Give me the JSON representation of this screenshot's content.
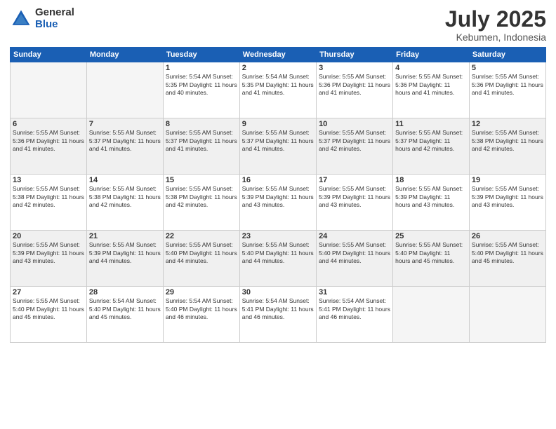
{
  "logo": {
    "general": "General",
    "blue": "Blue"
  },
  "title": "July 2025",
  "location": "Kebumen, Indonesia",
  "days_header": [
    "Sunday",
    "Monday",
    "Tuesday",
    "Wednesday",
    "Thursday",
    "Friday",
    "Saturday"
  ],
  "weeks": [
    [
      {
        "day": "",
        "info": ""
      },
      {
        "day": "",
        "info": ""
      },
      {
        "day": "1",
        "info": "Sunrise: 5:54 AM\nSunset: 5:35 PM\nDaylight: 11 hours and 40 minutes."
      },
      {
        "day": "2",
        "info": "Sunrise: 5:54 AM\nSunset: 5:35 PM\nDaylight: 11 hours and 41 minutes."
      },
      {
        "day": "3",
        "info": "Sunrise: 5:55 AM\nSunset: 5:36 PM\nDaylight: 11 hours and 41 minutes."
      },
      {
        "day": "4",
        "info": "Sunrise: 5:55 AM\nSunset: 5:36 PM\nDaylight: 11 hours and 41 minutes."
      },
      {
        "day": "5",
        "info": "Sunrise: 5:55 AM\nSunset: 5:36 PM\nDaylight: 11 hours and 41 minutes."
      }
    ],
    [
      {
        "day": "6",
        "info": "Sunrise: 5:55 AM\nSunset: 5:36 PM\nDaylight: 11 hours and 41 minutes."
      },
      {
        "day": "7",
        "info": "Sunrise: 5:55 AM\nSunset: 5:37 PM\nDaylight: 11 hours and 41 minutes."
      },
      {
        "day": "8",
        "info": "Sunrise: 5:55 AM\nSunset: 5:37 PM\nDaylight: 11 hours and 41 minutes."
      },
      {
        "day": "9",
        "info": "Sunrise: 5:55 AM\nSunset: 5:37 PM\nDaylight: 11 hours and 41 minutes."
      },
      {
        "day": "10",
        "info": "Sunrise: 5:55 AM\nSunset: 5:37 PM\nDaylight: 11 hours and 42 minutes."
      },
      {
        "day": "11",
        "info": "Sunrise: 5:55 AM\nSunset: 5:37 PM\nDaylight: 11 hours and 42 minutes."
      },
      {
        "day": "12",
        "info": "Sunrise: 5:55 AM\nSunset: 5:38 PM\nDaylight: 11 hours and 42 minutes."
      }
    ],
    [
      {
        "day": "13",
        "info": "Sunrise: 5:55 AM\nSunset: 5:38 PM\nDaylight: 11 hours and 42 minutes."
      },
      {
        "day": "14",
        "info": "Sunrise: 5:55 AM\nSunset: 5:38 PM\nDaylight: 11 hours and 42 minutes."
      },
      {
        "day": "15",
        "info": "Sunrise: 5:55 AM\nSunset: 5:38 PM\nDaylight: 11 hours and 42 minutes."
      },
      {
        "day": "16",
        "info": "Sunrise: 5:55 AM\nSunset: 5:39 PM\nDaylight: 11 hours and 43 minutes."
      },
      {
        "day": "17",
        "info": "Sunrise: 5:55 AM\nSunset: 5:39 PM\nDaylight: 11 hours and 43 minutes."
      },
      {
        "day": "18",
        "info": "Sunrise: 5:55 AM\nSunset: 5:39 PM\nDaylight: 11 hours and 43 minutes."
      },
      {
        "day": "19",
        "info": "Sunrise: 5:55 AM\nSunset: 5:39 PM\nDaylight: 11 hours and 43 minutes."
      }
    ],
    [
      {
        "day": "20",
        "info": "Sunrise: 5:55 AM\nSunset: 5:39 PM\nDaylight: 11 hours and 43 minutes."
      },
      {
        "day": "21",
        "info": "Sunrise: 5:55 AM\nSunset: 5:39 PM\nDaylight: 11 hours and 44 minutes."
      },
      {
        "day": "22",
        "info": "Sunrise: 5:55 AM\nSunset: 5:40 PM\nDaylight: 11 hours and 44 minutes."
      },
      {
        "day": "23",
        "info": "Sunrise: 5:55 AM\nSunset: 5:40 PM\nDaylight: 11 hours and 44 minutes."
      },
      {
        "day": "24",
        "info": "Sunrise: 5:55 AM\nSunset: 5:40 PM\nDaylight: 11 hours and 44 minutes."
      },
      {
        "day": "25",
        "info": "Sunrise: 5:55 AM\nSunset: 5:40 PM\nDaylight: 11 hours and 45 minutes."
      },
      {
        "day": "26",
        "info": "Sunrise: 5:55 AM\nSunset: 5:40 PM\nDaylight: 11 hours and 45 minutes."
      }
    ],
    [
      {
        "day": "27",
        "info": "Sunrise: 5:55 AM\nSunset: 5:40 PM\nDaylight: 11 hours and 45 minutes."
      },
      {
        "day": "28",
        "info": "Sunrise: 5:54 AM\nSunset: 5:40 PM\nDaylight: 11 hours and 45 minutes."
      },
      {
        "day": "29",
        "info": "Sunrise: 5:54 AM\nSunset: 5:40 PM\nDaylight: 11 hours and 46 minutes."
      },
      {
        "day": "30",
        "info": "Sunrise: 5:54 AM\nSunset: 5:41 PM\nDaylight: 11 hours and 46 minutes."
      },
      {
        "day": "31",
        "info": "Sunrise: 5:54 AM\nSunset: 5:41 PM\nDaylight: 11 hours and 46 minutes."
      },
      {
        "day": "",
        "info": ""
      },
      {
        "day": "",
        "info": ""
      }
    ]
  ]
}
